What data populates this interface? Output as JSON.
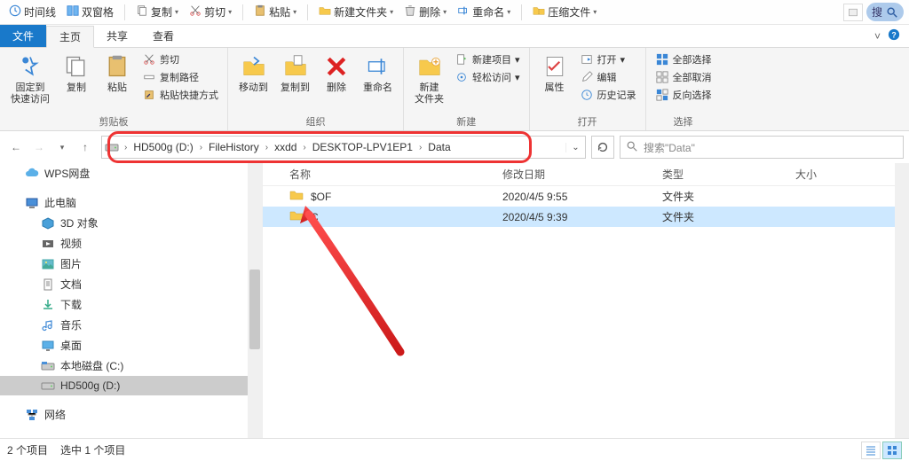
{
  "qat": {
    "timeline": "时间线",
    "dual_pane": "双窗格",
    "copy": "复制",
    "cut": "剪切",
    "paste": "粘贴",
    "new_folder": "新建文件夹",
    "delete": "删除",
    "rename": "重命名",
    "compress": "压缩文件",
    "search_placeholder": "搜"
  },
  "tabs": {
    "file": "文件",
    "home": "主页",
    "share": "共享",
    "view": "查看"
  },
  "ribbon": {
    "groups": {
      "clipboard": {
        "title": "剪贴板",
        "pin": "固定到\n快速访问",
        "copy": "复制",
        "paste": "粘贴",
        "cut": "剪切",
        "copy_path": "复制路径",
        "paste_shortcut": "粘贴快捷方式"
      },
      "organize": {
        "title": "组织",
        "move_to": "移动到",
        "copy_to": "复制到",
        "delete": "删除",
        "rename": "重命名"
      },
      "new": {
        "title": "新建",
        "new_folder": "新建\n文件夹",
        "new_item": "新建项目",
        "easy_access": "轻松访问"
      },
      "open": {
        "title": "打开",
        "properties": "属性",
        "open": "打开",
        "edit": "编辑",
        "history": "历史记录"
      },
      "select": {
        "title": "选择",
        "select_all": "全部选择",
        "select_none": "全部取消",
        "invert": "反向选择"
      }
    }
  },
  "breadcrumb": {
    "segments": [
      "HD500g (D:)",
      "FileHistory",
      "xxdd",
      "DESKTOP-LPV1EP1",
      "Data"
    ]
  },
  "search_placeholder": "搜索\"Data\"",
  "columns": {
    "name": "名称",
    "date": "修改日期",
    "type": "类型",
    "size": "大小"
  },
  "rows": [
    {
      "name": "$OF",
      "date": "2020/4/5 9:55",
      "type": "文件夹",
      "selected": false
    },
    {
      "name": "C",
      "date": "2020/4/5 9:39",
      "type": "文件夹",
      "selected": true
    }
  ],
  "sidebar": {
    "wps": "WPS网盘",
    "this_pc": "此电脑",
    "objects_3d": "3D 对象",
    "videos": "视频",
    "pictures": "图片",
    "documents": "文档",
    "downloads": "下载",
    "music": "音乐",
    "desktop": "桌面",
    "local_c": "本地磁盘 (C:)",
    "hd500g": "HD500g (D:)",
    "network": "网络"
  },
  "status": {
    "items": "2 个项目",
    "selected": "选中 1 个项目"
  }
}
